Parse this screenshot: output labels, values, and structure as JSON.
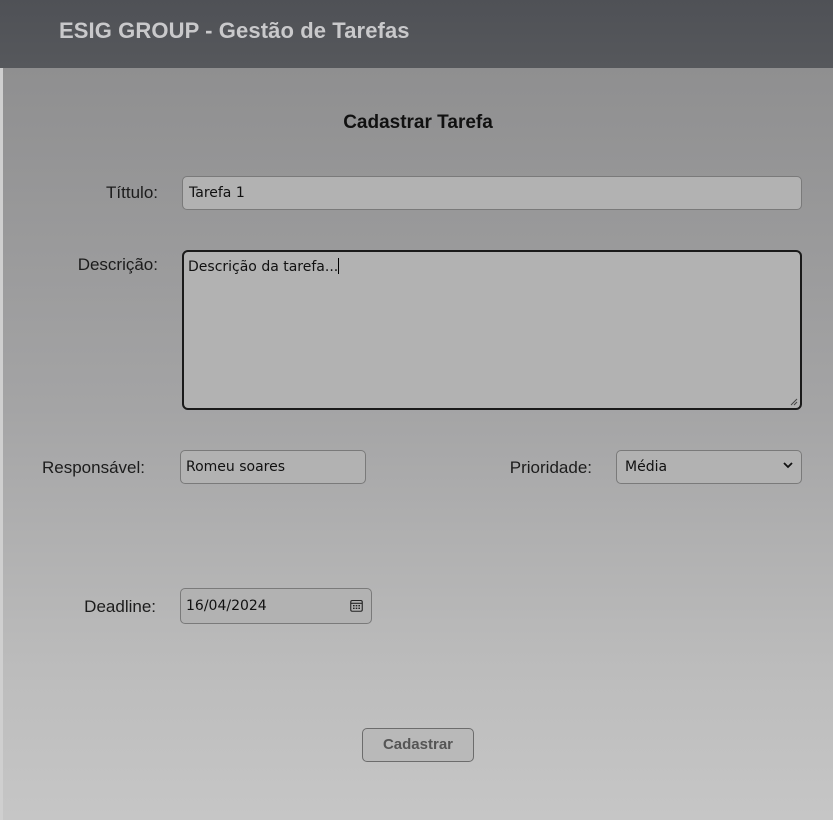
{
  "header": {
    "app_title": "ESIG GROUP - Gestão de Tarefas"
  },
  "form": {
    "title": "Cadastrar Tarefa",
    "titulo": {
      "label": "Títtulo:",
      "value": "Tarefa 1"
    },
    "descricao": {
      "label": "Descrição:",
      "value": "Descrição da tarefa..."
    },
    "responsavel": {
      "label": "Responsável:",
      "value": "Romeu soares"
    },
    "prioridade": {
      "label": "Prioridade:",
      "selected": "Média"
    },
    "deadline": {
      "label": "Deadline:",
      "value": "16/04/2024"
    },
    "submit_label": "Cadastrar"
  },
  "icons": {
    "select_arrow": "chevron-down-icon",
    "date_picker": "calendar-icon",
    "textarea_resize": "resize-grip-icon"
  },
  "colors": {
    "header_bg": "#53555a",
    "header_text": "#c9c9cb",
    "field_bg": "#b2b2b2"
  }
}
